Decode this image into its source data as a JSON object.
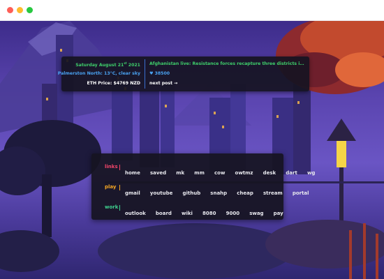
{
  "window": {
    "controls": [
      "close",
      "minimize",
      "maximize"
    ]
  },
  "info": {
    "date_prefix": "Saturday August 21",
    "date_suffix": "st",
    "date_year": " 2021",
    "weather": "Palmerston North: 13°C, clear sky",
    "eth_price": "ETH Price: $4769 NZD",
    "headline": "Afghanistan live: Resistance forces recapture three districts in Baghlan from...",
    "score": "38500",
    "next_post": "next post →"
  },
  "links": {
    "rows": [
      {
        "label": "links",
        "color": "#f2456a",
        "items": [
          "home",
          "saved",
          "mk",
          "mm",
          "cow",
          "owtmz",
          "desk",
          "dart",
          "wg"
        ]
      },
      {
        "label": "play",
        "color": "#f5a623",
        "items": [
          "gmail",
          "youtube",
          "github",
          "snahp",
          "cheap",
          "stream",
          "portal"
        ]
      },
      {
        "label": "work",
        "color": "#3fcf8e",
        "items": [
          "outlook",
          "board",
          "wiki",
          "8080",
          "9000",
          "swag",
          "pay"
        ]
      }
    ]
  },
  "colors": {
    "green": "#3fcf6b",
    "blue": "#4aa3f2",
    "panel": "#161422"
  }
}
